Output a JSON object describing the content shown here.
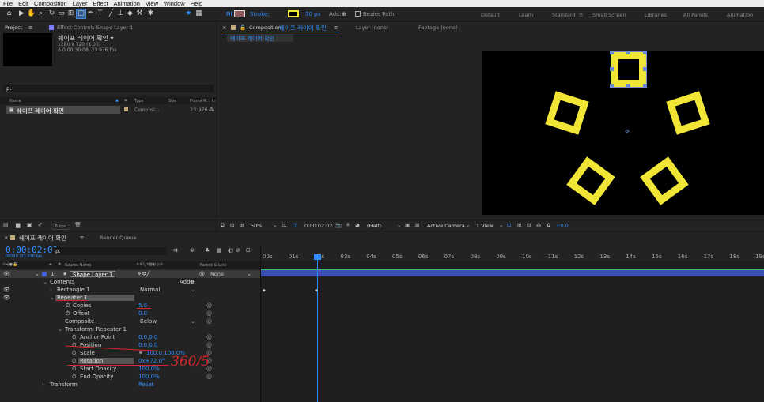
{
  "menu": [
    "File",
    "Edit",
    "Composition",
    "Layer",
    "Effect",
    "Animation",
    "View",
    "Window",
    "Help"
  ],
  "toolbar": {
    "fill_label": "Fill:",
    "stroke_label": "Stroke:",
    "stroke_width": "30 px",
    "add_label": "Add:",
    "bezier_label": "Bezier Path",
    "colors": {
      "fill": "#8c5a5a",
      "stroke": "#f1e636"
    }
  },
  "workspaces": [
    "Default",
    "Learn",
    "Standard",
    "Small Screen",
    "Libraries",
    "All Panels",
    "Animation"
  ],
  "project": {
    "tab": "Project",
    "effect_tab": "Effect Controls Shape Layer 1",
    "comp_name": "쉐이프 레이어 확인 ▾",
    "comp_size": "1280 x 720 (1.00)",
    "comp_dur": "Δ 0:00:30:08, 23.976 fps",
    "search_placeholder": "ρ.",
    "col_name": "Name",
    "col_type": "Type",
    "col_size": "Size",
    "col_frame": "Frame R...",
    "col_in": "In",
    "item_name": "쉐이프 레이어 확인",
    "item_type": "Composi...",
    "item_fps": "23.976",
    "bpc": "8 bpc"
  },
  "viewer": {
    "comp_tab_prefix": "Composition",
    "comp_tab_name": "쉐이프 레이어 확인",
    "layer_tab": "Layer (none)",
    "footage_tab": "Footage (none)",
    "sub_tab": "쉐이프 레이어 확인",
    "zoom": "50%",
    "timecode": "0:00:02:02",
    "res": "(Half)",
    "camera": "Active Camera",
    "view": "1 View",
    "exposure": "+0.0"
  },
  "timeline": {
    "comp_tab": "쉐이프 레이어 확인",
    "render_tab": "Render Queue",
    "timecode": "0:00:02:02",
    "frames": "00050 (23.976 fps)",
    "search_placeholder": "ρ.",
    "col_source": "Source Name",
    "col_parent": "Parent & Link",
    "layer": {
      "num": "1",
      "name": "Shape Layer 1",
      "parent": "None"
    },
    "contents": "Contents",
    "add": "Add:",
    "rect": "Rectangle 1",
    "rect_mode": "Normal",
    "repeater": "Repeater 1",
    "props": [
      {
        "label": "Copies",
        "value": "5.0"
      },
      {
        "label": "Offset",
        "value": "0.0"
      },
      {
        "label": "Composite",
        "value": "Below"
      }
    ],
    "transform_rep": "Transform: Repeater 1",
    "tprops": [
      {
        "label": "Anchor Point",
        "value": "0.0,0.0"
      },
      {
        "label": "Position",
        "value": "0.0,0.0"
      },
      {
        "label": "Scale",
        "value": "100.0,100.0%"
      },
      {
        "label": "Rotation",
        "value": "0x+72.0°"
      },
      {
        "label": "Start Opacity",
        "value": "100.0%"
      },
      {
        "label": "End Opacity",
        "value": "100.0%"
      }
    ],
    "transform": "Transform",
    "reset": "Reset",
    "annotation": "360/5",
    "ticks": [
      "00s",
      "01s",
      "02s",
      "03s",
      "04s",
      "05s",
      "06s",
      "07s",
      "08s",
      "09s",
      "10s",
      "11s",
      "12s",
      "13s",
      "14s",
      "15s",
      "16s",
      "17s",
      "18s",
      "19s"
    ]
  }
}
